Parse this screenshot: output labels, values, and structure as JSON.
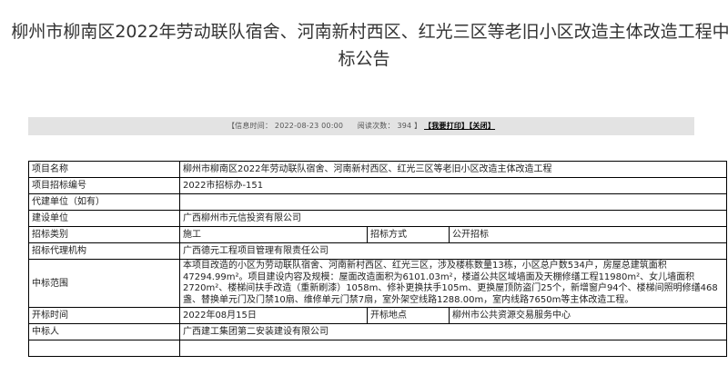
{
  "title": {
    "line1": "柳州市柳南区2022年劳动联队宿舍、河南新村西区、红光三区等老旧小区改造主体改造工程中",
    "line2": "标公告"
  },
  "info_bar": {
    "time_label": "【信息时间：",
    "time_value": "2022-08-23 00:00",
    "reads_label": "阅读次数：",
    "reads_value": "394",
    "close_bracket": "】",
    "print_link": "【我要打印】",
    "close_link": "【关闭】"
  },
  "fields": {
    "project_name": {
      "label": "项目名称",
      "value": "柳州市柳南区2022年劳动联队宿舍、河南新村西区、红光三区等老旧小区改造主体改造工程"
    },
    "bid_number": {
      "label": "项目招标编号",
      "value": "2022市招标办-151"
    },
    "agent_unit": {
      "label": "代建单位（如有）",
      "value": ""
    },
    "builder": {
      "label": "建设单位",
      "value": "广西柳州市元信投资有限公司"
    },
    "bid_category": {
      "label": "招标类别",
      "value": "施工"
    },
    "bid_method": {
      "label": "招标方式",
      "value": "公开招标"
    },
    "agency": {
      "label": "招标代理机构",
      "value": "广西德元工程项目管理有限责任公司"
    },
    "scope": {
      "label": "中标范围",
      "value": "本项目改造的小区为劳动联队宿舍、河南新村西区、红光三区，涉及楼栋数量13栋，小区总户数534户，房屋总建筑面积47294.99m²。项目建设内容及规模：屋面改造面积为6101.03m²，楼道公共区域墙面及天棚修缮工程11980m²、女儿墙面积2720m²、楼梯间扶手改造（重新刷漆）1058m、修补更换扶手105m、更换屋顶防盗门25个，新增窗户94个、楼梯间照明修缮468盏、替换单元门及门禁10扇、维修单元门禁7扇，室外架空线路1288.00m，室内线路7650m等主体改造工程。"
    },
    "open_time": {
      "label": "开标时间",
      "value": "2022年08月15日"
    },
    "open_place": {
      "label": "开标地点",
      "value": "柳州市公共资源交易服务中心"
    },
    "winner": {
      "label": "中标人",
      "value": "广西建工集团第二安装建设有限公司"
    }
  }
}
